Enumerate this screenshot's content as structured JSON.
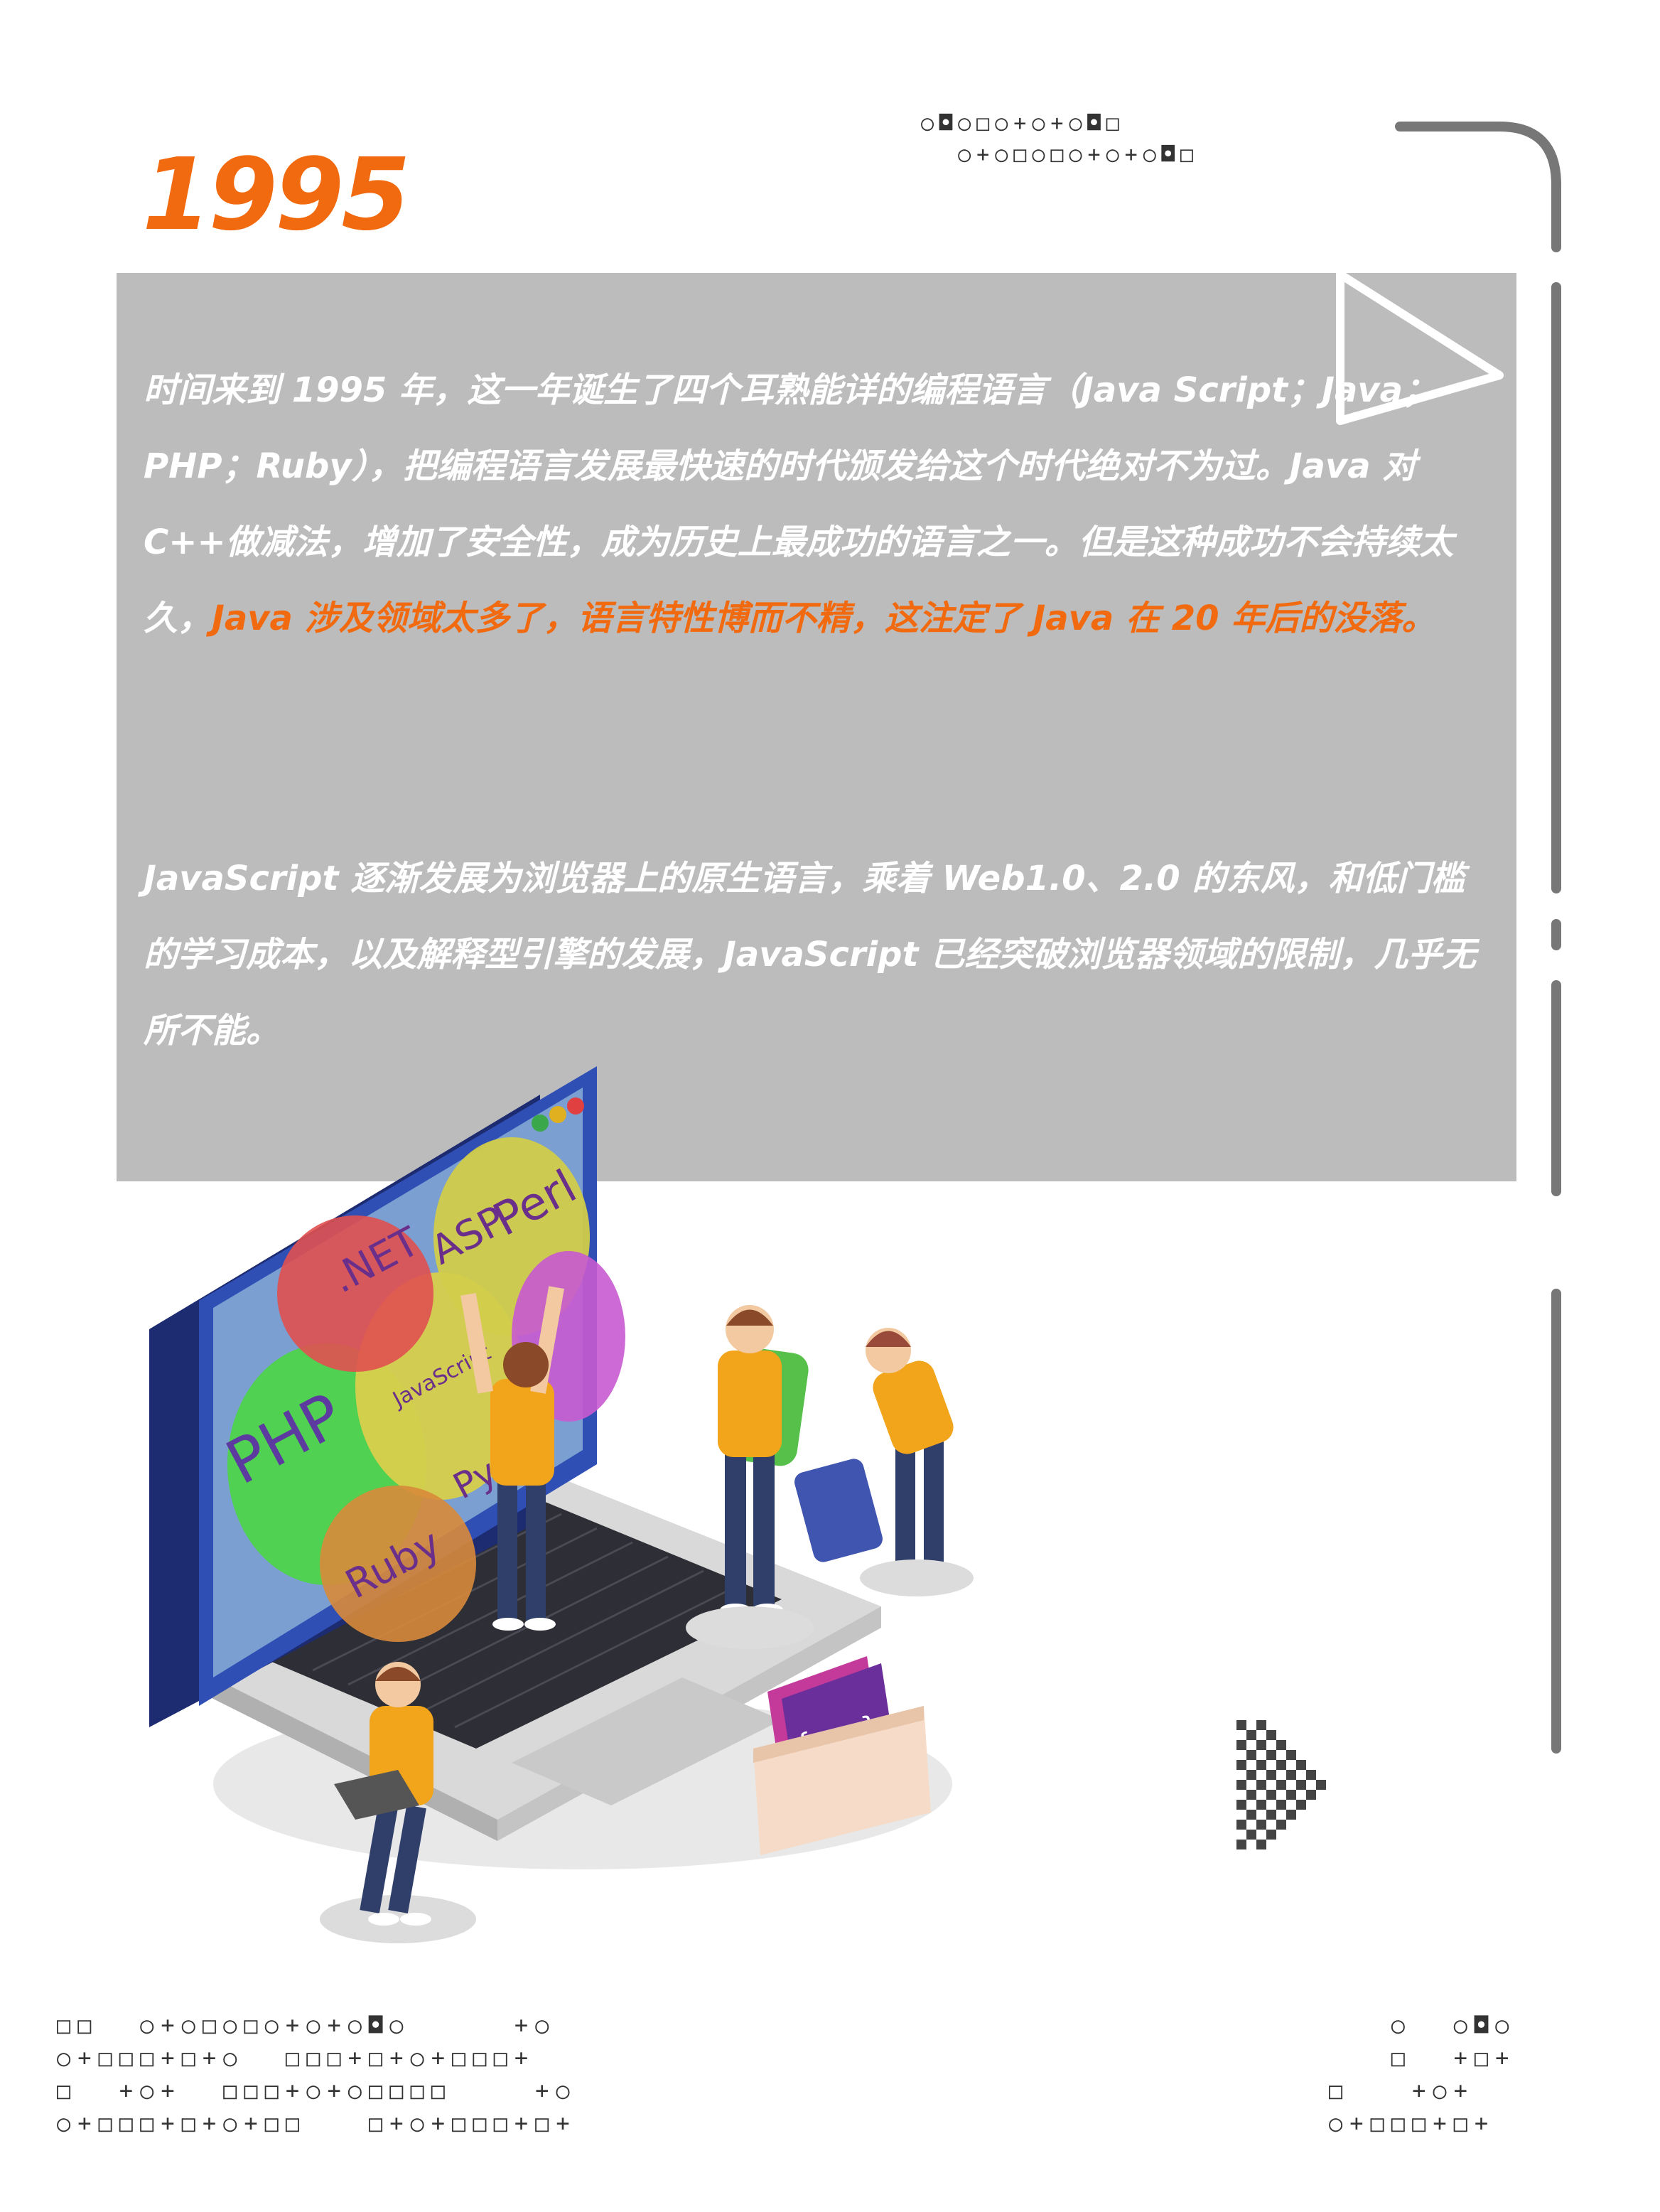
{
  "heading": {
    "year": "1995"
  },
  "paragraph1": {
    "normal": "时间来到 1995 年，这一年诞生了四个耳熟能详的编程语言（Java Script；Java；PHP；Ruby），把编程语言发展最快速的时代颁发给这个时代绝对不为过。Java 对 C++做减法，增加了安全性，成为历史上最成功的语言之一。但是这种成功不会持续太久，",
    "highlight": "Java 涉及领域太多了，语言特性博而不精，这注定了 Java 在 20 年后的没落。"
  },
  "paragraph2": {
    "text": "JavaScript 逐渐发展为浏览器上的原生语言，乘着 Web1.0、2.0 的东风，和低门槛的学习成本，以及解释型引擎的发展，JavaScript 已经突破浏览器领域的限制，几乎无所不能。"
  },
  "screen_labels": {
    "net": ".NET",
    "asp": "ASP",
    "perl": "Perl",
    "php": "PHP",
    "javascript": "JavaScript",
    "ruby": "Ruby",
    "py": "Py"
  },
  "code_box_label": "{...}",
  "decor": {
    "top_dots": "○◘○□○+○+○◘□\n  ○+○□○□○+○+○◘□",
    "bottom_left_dots": "□□  ○+○□○□○+○+○◘○     +○\n○+□□□+□+○  □□□+□+○+□□□+\n□  +○+  □□□+○+○□□□□    +○\n○+□□□+□+○+□□   □+○+□□□+□+",
    "bottom_right_dots": "   ○  ○◘○\n   □  +□+\n□   +○+\n○+□□□+□+"
  },
  "colors": {
    "accent": "#f26a0f",
    "panel": "#bcbcbc",
    "text": "#ffffff"
  }
}
